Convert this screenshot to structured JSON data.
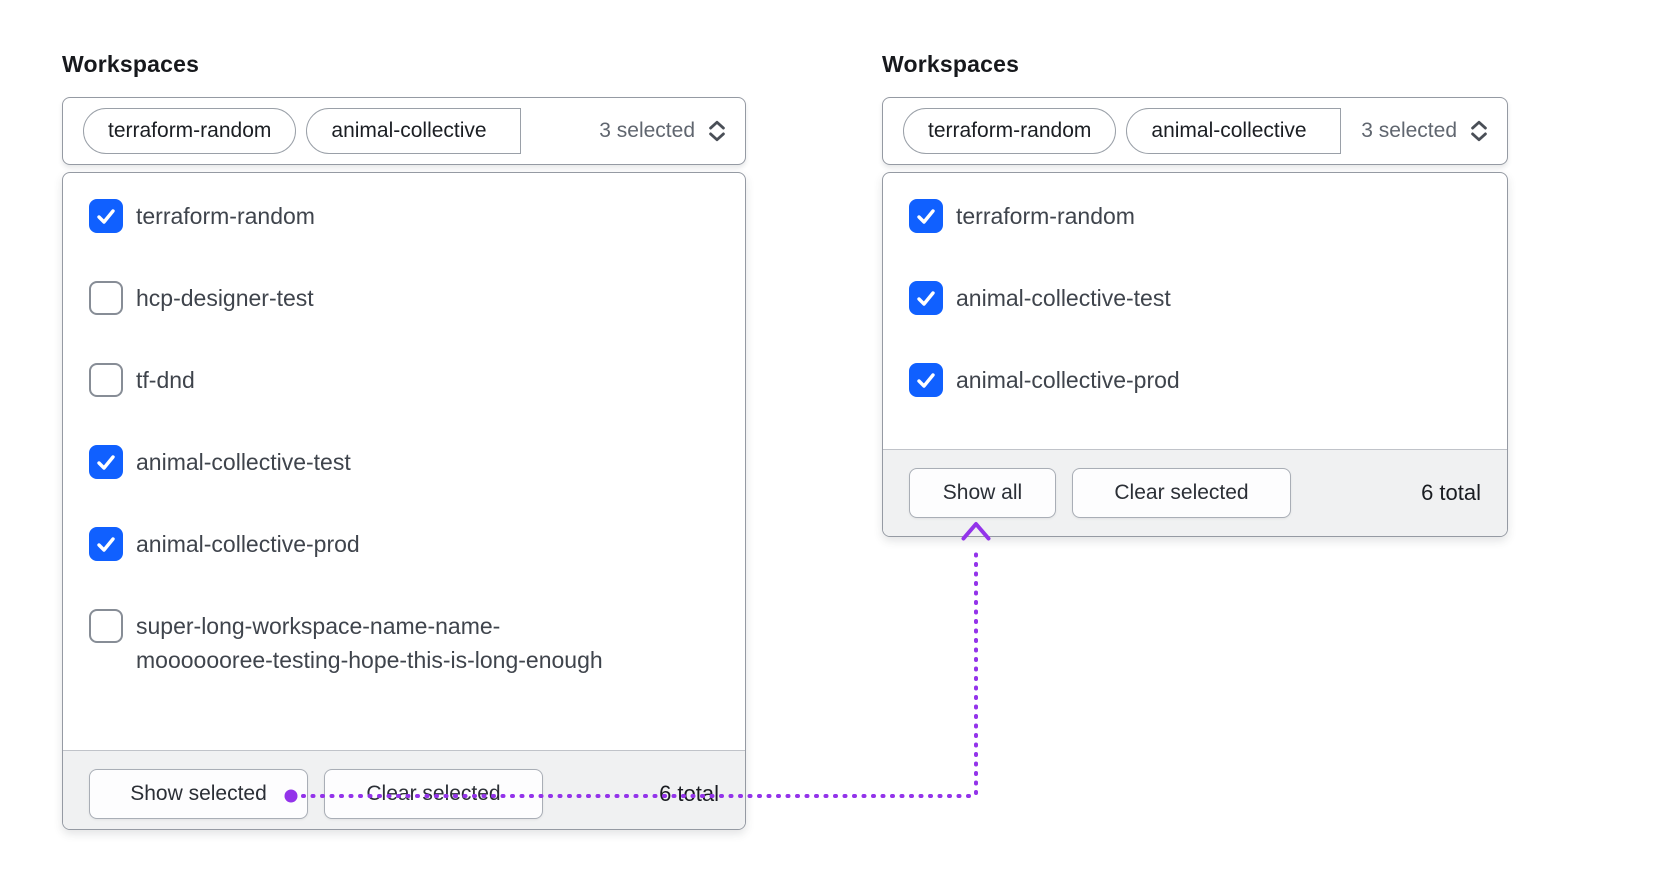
{
  "colors": {
    "checkbox_checked_blue": "#1060ff",
    "annotation_purple": "#9333ea"
  },
  "panels": [
    {
      "label": "Workspaces",
      "trigger": {
        "pills": [
          "terraform-random",
          "animal-collective"
        ],
        "count_label": "3 selected"
      },
      "items": [
        {
          "label": "terraform-random",
          "checked": true
        },
        {
          "label": "hcp-designer-test",
          "checked": false
        },
        {
          "label": "tf-dnd",
          "checked": false
        },
        {
          "label": "animal-collective-test",
          "checked": true
        },
        {
          "label": "animal-collective-prod",
          "checked": true
        },
        {
          "label": "super-long-workspace-name-name-\nmooooooree-testing-hope-this-is-long-enough",
          "checked": false
        }
      ],
      "footer": {
        "buttons": [
          "Show selected",
          "Clear selected"
        ],
        "total_label": "6 total"
      }
    },
    {
      "label": "Workspaces",
      "trigger": {
        "pills": [
          "terraform-random",
          "animal-collective"
        ],
        "count_label": "3 selected"
      },
      "items": [
        {
          "label": "terraform-random",
          "checked": true
        },
        {
          "label": "animal-collective-test",
          "checked": true
        },
        {
          "label": "animal-collective-prod",
          "checked": true
        }
      ],
      "footer": {
        "buttons": [
          "Show all",
          "Clear selected"
        ],
        "total_label": "6 total"
      }
    }
  ]
}
